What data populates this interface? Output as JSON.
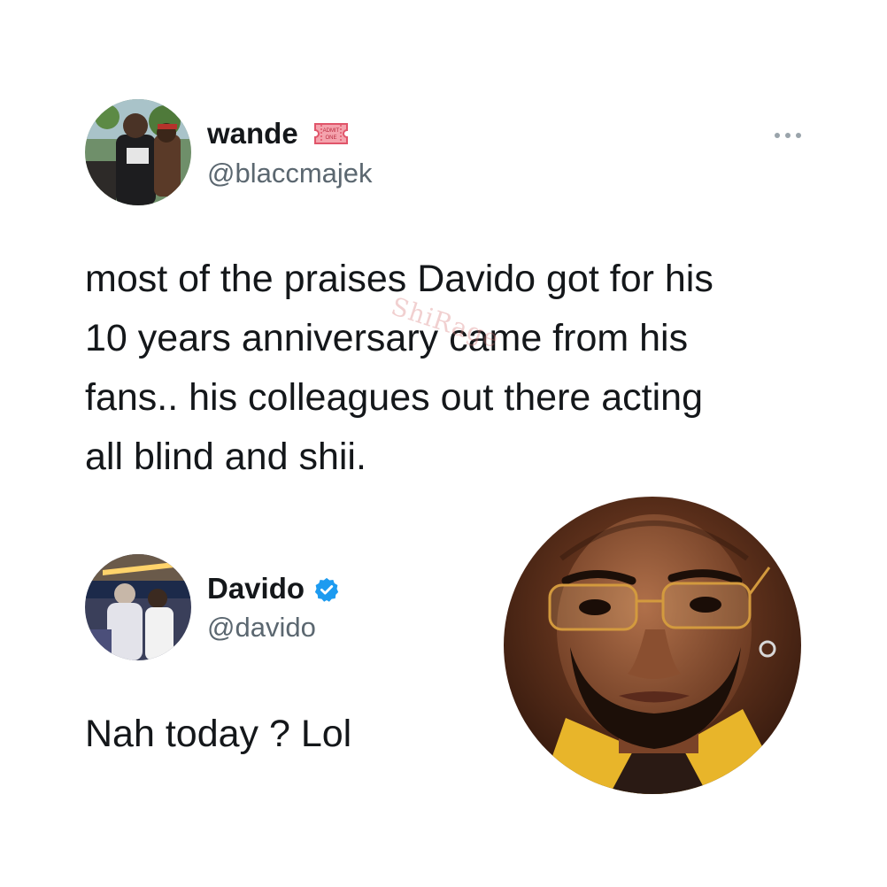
{
  "tweet1": {
    "display_name": "wande",
    "badge_icon": "admit-one-ticket-icon",
    "badge_text": "ADMIT ONE",
    "handle": "@blaccmajek",
    "more_icon": "more-horizontal-icon",
    "text_lines": [
      "most of the praises Davido got for his",
      "10 years anniversary came from his",
      "fans.. his colleagues out there acting",
      "all blind and shii."
    ]
  },
  "tweet2": {
    "display_name": "Davido",
    "verified_icon": "verified-badge-icon",
    "handle": "@davido",
    "text": "Nah today ? Lol"
  },
  "watermark": "ShiRage",
  "colors": {
    "text": "#14171a",
    "handle": "#5b6770",
    "verified": "#1d9bf0",
    "ticket": "#e0556a"
  }
}
